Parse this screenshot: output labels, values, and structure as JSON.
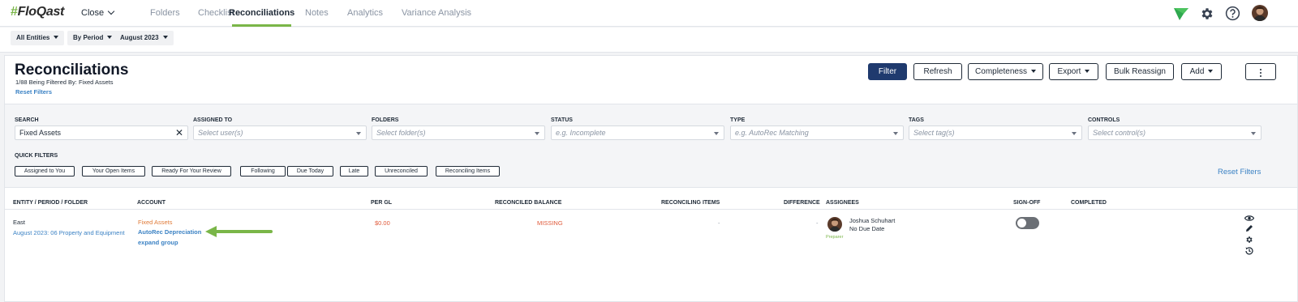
{
  "brand": {
    "logo_text": "FloQast",
    "hash": "#"
  },
  "nav": {
    "close_label": "Close",
    "items": [
      "Folders",
      "Checklist",
      "Reconciliations",
      "Notes",
      "Analytics",
      "Variance Analysis"
    ]
  },
  "subbar": {
    "entities": "All Entities",
    "period_mode": "By Period",
    "period": "August 2023"
  },
  "header": {
    "title": "Reconciliations",
    "subtitle": "1/88 Being Filtered By: Fixed Assets",
    "reset_filters": "Reset Filters"
  },
  "toolbar": {
    "filter": "Filter",
    "refresh": "Refresh",
    "completeness": "Completeness",
    "export": "Export",
    "bulk_reassign": "Bulk Reassign",
    "add": "Add"
  },
  "filters": {
    "search": {
      "label": "SEARCH",
      "value": "Fixed Assets"
    },
    "assigned_to": {
      "label": "ASSIGNED TO",
      "placeholder": "Select user(s)"
    },
    "folders": {
      "label": "FOLDERS",
      "placeholder": "Select folder(s)"
    },
    "status": {
      "label": "STATUS",
      "placeholder": "e.g. Incomplete"
    },
    "type": {
      "label": "TYPE",
      "placeholder": "e.g. AutoRec Matching"
    },
    "tags": {
      "label": "TAGS",
      "placeholder": "Select tag(s)"
    },
    "controls": {
      "label": "CONTROLS",
      "placeholder": "Select control(s)"
    },
    "quick_filters_label": "QUICK FILTERS",
    "quick_filters": [
      "Assigned to You",
      "Your Open Items",
      "Ready For Your Review",
      "Following",
      "Due Today",
      "Late",
      "Unreconciled",
      "Reconciling Items"
    ],
    "reset_filters": "Reset Filters"
  },
  "table": {
    "headers": {
      "entity": "ENTITY / PERIOD / FOLDER",
      "account": "ACCOUNT",
      "per_gl": "PER GL",
      "reconciled_balance": "RECONCILED BALANCE",
      "reconciling_items": "RECONCILING ITEMS",
      "difference": "DIFFERENCE",
      "assignees": "ASSIGNEES",
      "sign_off": "SIGN-OFF",
      "completed": "COMPLETED"
    },
    "row": {
      "entity": "East",
      "folder": "August 2023: 06 Property and Equipment",
      "account_group": "Fixed Assets",
      "account": "AutoRec Depreciation",
      "expand": "expand group",
      "per_gl": "$0.00",
      "reconciled_balance": "MISSING",
      "reconciling_items": "-",
      "difference": "-",
      "assignee_name": "Joshua Schuhart",
      "due": "No Due Date",
      "role": "Preparer",
      "sign_off": false
    }
  },
  "colors": {
    "accent": "#7ab648",
    "primary": "#1f3a6e",
    "link": "#3b82c4",
    "warning": "#e07b39"
  }
}
